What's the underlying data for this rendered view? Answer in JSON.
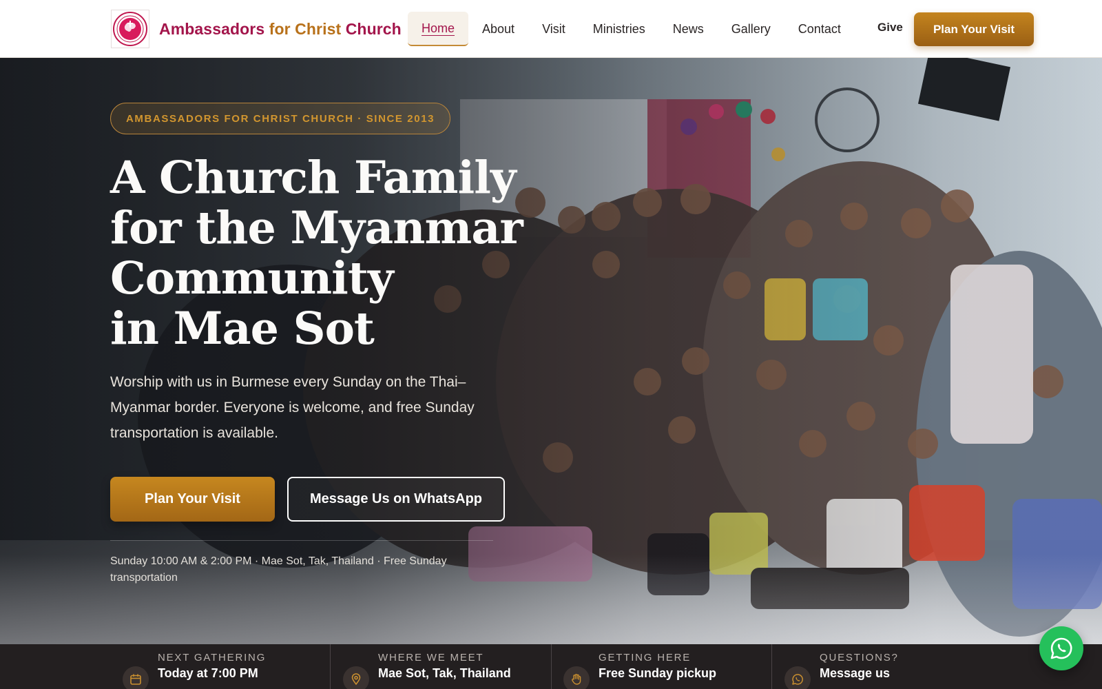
{
  "header": {
    "brand_part1": "Ambassadors ",
    "brand_part2": "for Christ ",
    "brand_part3": "Church",
    "nav": [
      {
        "label": "Home"
      },
      {
        "label": "About"
      },
      {
        "label": "Visit"
      },
      {
        "label": "Ministries"
      },
      {
        "label": "News"
      },
      {
        "label": "Gallery"
      },
      {
        "label": "Contact"
      }
    ],
    "give_label": "Give",
    "cta_label": "Plan Your Visit"
  },
  "hero": {
    "eyebrow": "AMBASSADORS FOR CHRIST CHURCH · SINCE 2013",
    "title_line1": "A Church Family",
    "title_line2": "for the Myanmar",
    "title_line3": "Community",
    "title_line4": "in Mae Sot",
    "subtitle": "Worship with us in Burmese every Sunday on the Thai–Myanmar border. Everyone is welcome, and free Sunday transportation is available.",
    "primary_cta": "Plan Your Visit",
    "secondary_cta": "Message Us on WhatsApp",
    "meta": "Sunday 10:00 AM & 2:00 PM · Mae Sot, Tak, Thailand · Free Sunday transportation"
  },
  "infobar": {
    "items": [
      {
        "label": "NEXT GATHERING",
        "value": "Today at 7:00 PM",
        "icon": "calendar-icon"
      },
      {
        "label": "WHERE WE MEET",
        "value": "Mae Sot, Tak, Thailand",
        "icon": "map-pin-icon"
      },
      {
        "label": "GETTING HERE",
        "value": "Free Sunday pickup",
        "icon": "hand-wave-icon"
      },
      {
        "label": "QUESTIONS?",
        "value": "Message us",
        "icon": "whatsapp-icon"
      }
    ]
  },
  "colors": {
    "brand_crimson": "#a3154b",
    "brand_gold": "#b8711a",
    "cta_gold": "#c4841e",
    "info_bar_bg": "#231f20",
    "whatsapp_green": "#25c05b"
  }
}
